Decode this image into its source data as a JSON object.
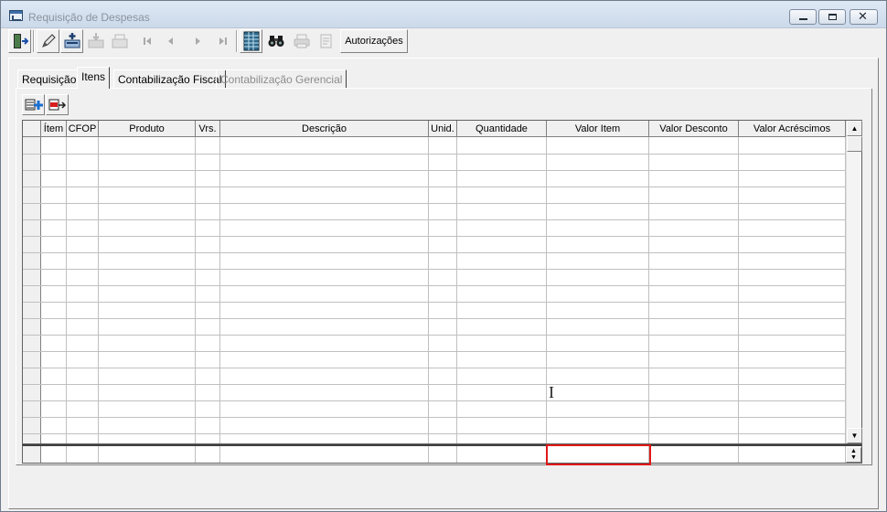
{
  "window": {
    "title": "Requisição de Despesas"
  },
  "toolbar": {
    "buttons": [
      {
        "icon": "exit-door-icon"
      },
      {
        "icon": "pencil-edit-icon"
      },
      {
        "icon": "add-record-icon"
      },
      {
        "icon": "save-icon"
      },
      {
        "icon": "print-icon"
      },
      {
        "icon": "first-record-icon"
      },
      {
        "icon": "previous-record-icon"
      },
      {
        "icon": "next-record-icon"
      },
      {
        "icon": "last-record-icon"
      },
      {
        "icon": "spreadsheet-icon"
      },
      {
        "icon": "binoculars-icon"
      },
      {
        "icon": "printer-icon"
      },
      {
        "icon": "document-icon"
      }
    ],
    "authorizations_label": "Autorizações"
  },
  "tabs": [
    {
      "label": "Requisição",
      "active": false,
      "enabled": true
    },
    {
      "label": "Itens",
      "active": true,
      "enabled": true
    },
    {
      "label": "Contabilização Fiscal",
      "active": false,
      "enabled": true
    },
    {
      "label": "Contabilização Gerencial",
      "active": false,
      "enabled": false
    }
  ],
  "items_toolbar": [
    {
      "icon": "add-item-icon"
    },
    {
      "icon": "remove-item-icon"
    }
  ],
  "grid": {
    "columns": [
      "Ítem",
      "CFOP",
      "Produto",
      "Vrs.",
      "Descrição",
      "Unid.",
      "Quantidade",
      "Valor Item",
      "Valor Desconto",
      "Valor Acréscimos"
    ],
    "rows": []
  },
  "colors": {
    "highlight": "#e01818",
    "face": "#f0f0f0"
  }
}
